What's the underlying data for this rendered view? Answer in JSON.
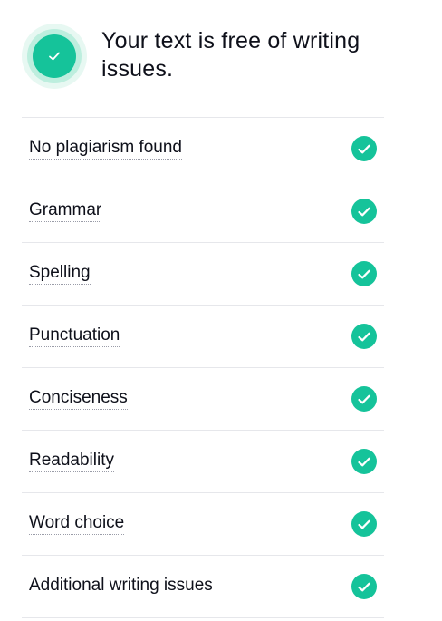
{
  "header": {
    "title": "Your text is free of writing issues.",
    "status_icon": "check-circle-icon",
    "accent_color": "#15c39a"
  },
  "checks": [
    {
      "label": "No plagiarism found",
      "icon": "check-circle-icon"
    },
    {
      "label": "Grammar",
      "icon": "check-circle-icon"
    },
    {
      "label": "Spelling",
      "icon": "check-circle-icon"
    },
    {
      "label": "Punctuation",
      "icon": "check-circle-icon"
    },
    {
      "label": "Conciseness",
      "icon": "check-circle-icon"
    },
    {
      "label": "Readability",
      "icon": "check-circle-icon"
    },
    {
      "label": "Word choice",
      "icon": "check-circle-icon"
    },
    {
      "label": "Additional writing issues",
      "icon": "check-circle-icon"
    }
  ]
}
